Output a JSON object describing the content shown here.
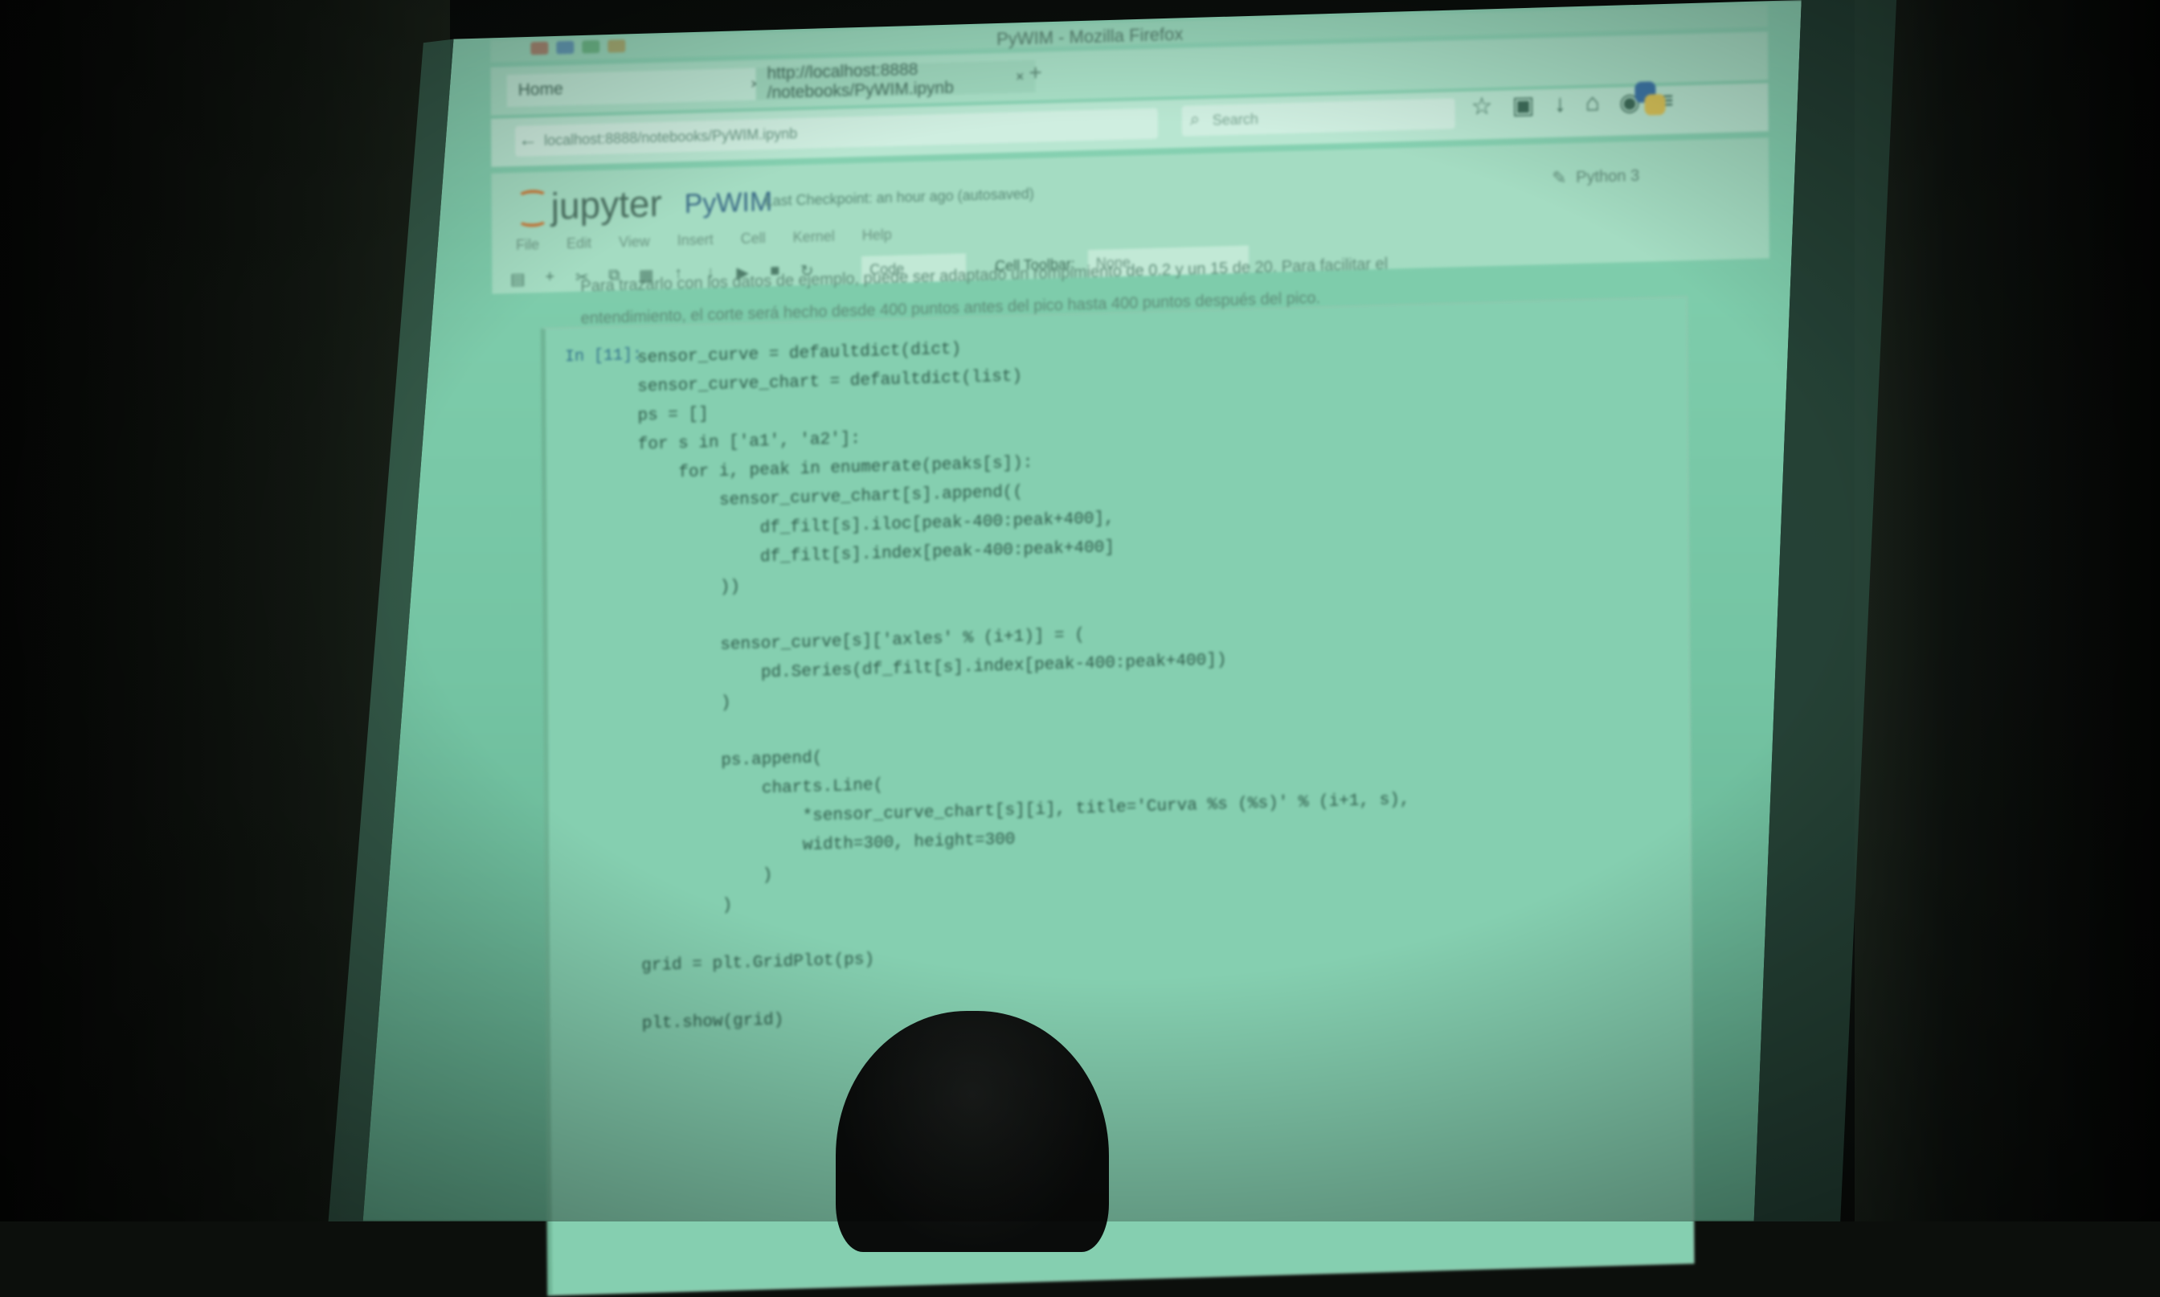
{
  "window": {
    "title": "PyWIM - Mozilla Firefox"
  },
  "tabs": [
    {
      "label": "Home"
    },
    {
      "label": "http://localhost:8888 /notebooks/PyWIM.ipynb"
    }
  ],
  "address_bar": {
    "url": "localhost:8888/notebooks/PyWIM.ipynb",
    "search_placeholder": "Search"
  },
  "notebook": {
    "logo_text": "jupyter",
    "title": "PyWIM",
    "checkpoint": "Last Checkpoint: an hour ago (autosaved)",
    "kernel": "Python 3",
    "menu": [
      "File",
      "Edit",
      "View",
      "Insert",
      "Cell",
      "Kernel",
      "Help"
    ],
    "cell_type": "Code",
    "celltoolbar_label": "Cell Toolbar:",
    "celltoolbar_value": "None"
  },
  "markdown_lines": [
    "Para trazarlo con los datos de ejemplo, puede ser adaptado un rompimiento de 0.2 y un 15 de 20. Para facilitar el",
    "entendimiento, el corte será hecho desde 400 puntos antes del pico hasta 400 puntos después del pico."
  ],
  "code_prompt": "In [11]:",
  "code_lines": [
    "sensor_curve = defaultdict(dict)",
    "sensor_curve_chart = defaultdict(list)",
    "ps = []",
    "for s in ['a1', 'a2']:",
    "    for i, peak in enumerate(peaks[s]):",
    "        sensor_curve_chart[s].append((",
    "            df_filt[s].iloc[peak-400:peak+400],",
    "            df_filt[s].index[peak-400:peak+400]",
    "        ))",
    "",
    "        sensor_curve[s]['axles' % (i+1)] = (",
    "            pd.Series(df_filt[s].index[peak-400:peak+400])",
    "        )",
    "",
    "        ps.append(",
    "            charts.Line(",
    "                *sensor_curve_chart[s][i], title='Curva %s (%s)' % (i+1, s),",
    "                width=300, height=300",
    "            )",
    "        )",
    "",
    "grid = plt.GridPlot(ps)",
    "",
    "plt.show(grid)"
  ]
}
